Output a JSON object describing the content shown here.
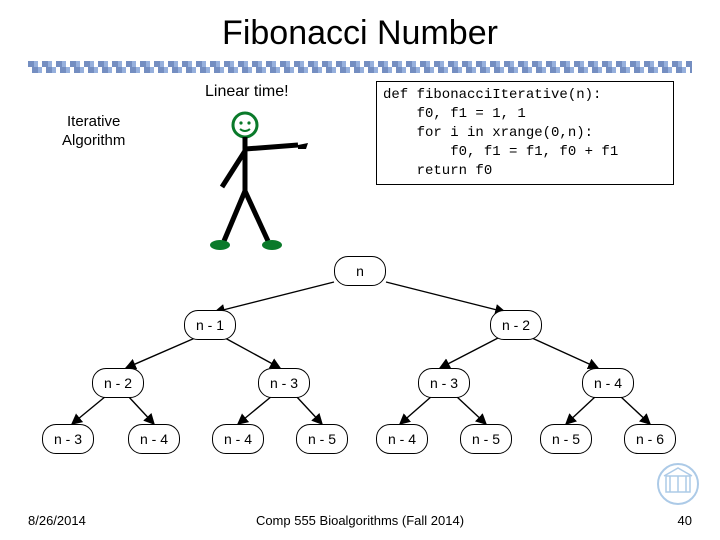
{
  "title": "Fibonacci Number",
  "annotation": "Linear time!",
  "algorithm_label_line1": "Iterative",
  "algorithm_label_line2": "Algorithm",
  "code": "def fibonacciIterative(n):\n    f0, f1 = 1, 1\n    for i in xrange(0,n):\n        f0, f1 = f1, f0 + f1\n    return f0",
  "tree": {
    "level0": [
      "n"
    ],
    "level1": [
      "n - 1",
      "n - 2"
    ],
    "level2": [
      "n - 2",
      "n - 3",
      "n - 3",
      "n - 4"
    ],
    "level3": [
      "n - 3",
      "n - 4",
      "n - 4",
      "n - 5",
      "n - 4",
      "n - 5",
      "n - 5",
      "n - 6"
    ]
  },
  "footer": {
    "date": "8/26/2014",
    "center": "Comp 555 Bioalgorithms (Fall 2014)",
    "page": "40"
  }
}
